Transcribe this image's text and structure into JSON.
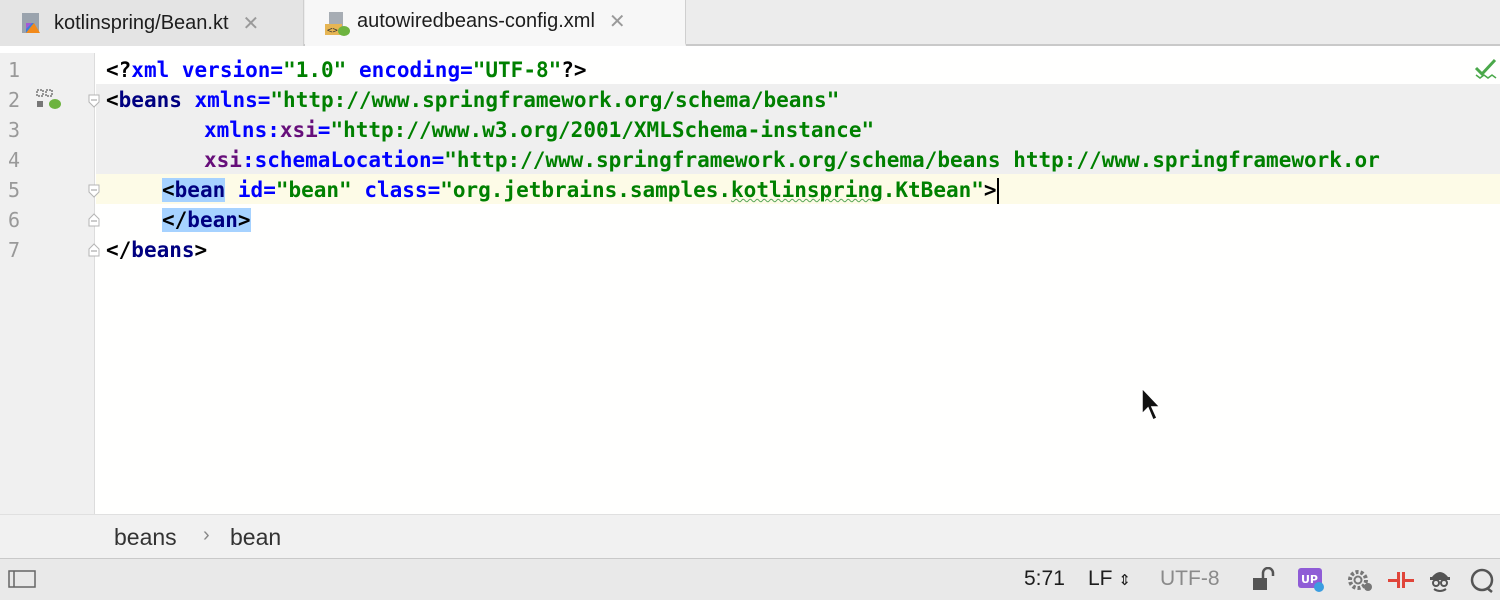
{
  "tabs": [
    {
      "label": "kotlinspring/Bean.kt",
      "close": "✕",
      "icon": "kotlin-file-icon",
      "active": false
    },
    {
      "label": "autowiredbeans-config.xml",
      "close": "✕",
      "icon": "spring-xml-file-icon",
      "active": true
    }
  ],
  "editor": {
    "line_numbers": [
      "1",
      "2",
      "3",
      "4",
      "5",
      "6",
      "7"
    ],
    "lines": {
      "l1": {
        "a": "<?",
        "b": "xml",
        "c": " ",
        "d": "version",
        "e": "=",
        "f": "\"1.0\"",
        "g": " ",
        "h": "encoding",
        "i": "=",
        "j": "\"UTF-8\"",
        "k": "?>"
      },
      "l2": {
        "a": "<",
        "b": "beans",
        "c": " ",
        "d": "xmlns",
        "e": "=",
        "f": "\"http://www.springframework.org/schema/beans\""
      },
      "l3": {
        "a": "xmlns:",
        "b": "xsi",
        "c": "=",
        "d": "\"http://www.w3.org/2001/XMLSchema-instance\""
      },
      "l4": {
        "a": "xsi",
        "b": ":schemaLocation",
        "c": "=",
        "d": "\"http://www.springframework.org/schema/beans http://www.springframework.or"
      },
      "l5": {
        "a": "<",
        "b": "bean",
        "c": " ",
        "d": "id",
        "e": "=",
        "f": "\"bean\"",
        "g": " ",
        "h": "class",
        "i": "=",
        "j": "\"org.jetbrains.samples.",
        "k": "kotlinspring",
        "l": ".KtBean\"",
        "m": ">"
      },
      "l6": {
        "a": "</",
        "b": "bean",
        "c": ">"
      },
      "l7": {
        "a": "</",
        "b": "beans",
        "c": ">"
      }
    },
    "inspection_status": "ok-check-icon"
  },
  "breadcrumb": {
    "items": [
      "beans",
      "bean"
    ],
    "separator": "›"
  },
  "statusbar": {
    "position": "5:71",
    "line_separator": "LF",
    "line_separator_arrow": "⇕",
    "encoding": "UTF-8",
    "icons": [
      "lock-open-icon",
      "upsource-icon",
      "settings-gear-icon",
      "spring-icon",
      "inspector-icon",
      "notifications-icon"
    ]
  },
  "colors": {
    "tag": "#000080",
    "attr": "#0000ff",
    "value": "#008000",
    "namespace": "#660e7a",
    "selection": "#a6d2ff",
    "caret_line": "#fdfbe7"
  }
}
